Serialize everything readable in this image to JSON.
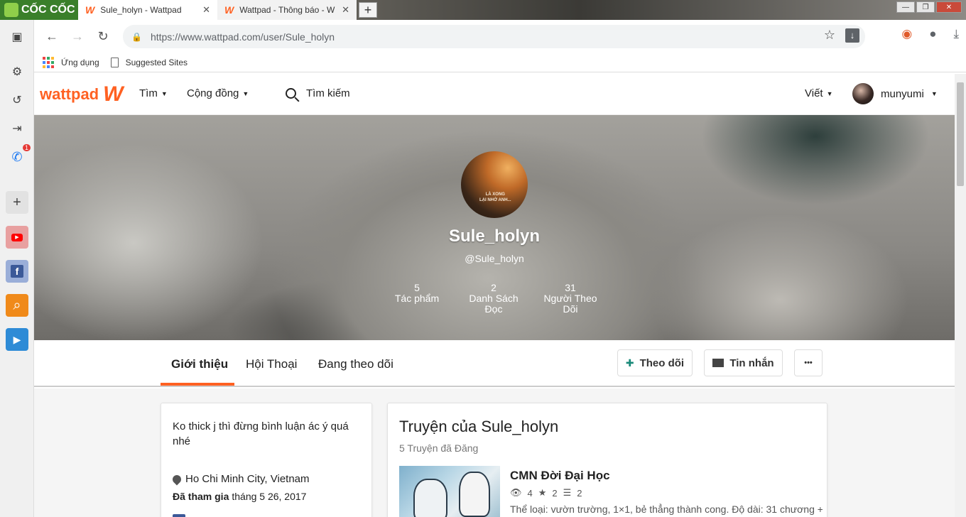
{
  "browser": {
    "brand": "CỐC CỐC",
    "tabs": [
      {
        "title": "Sule_holyn - Wattpad",
        "close": "✕"
      },
      {
        "title": "Wattpad - Thông báo - W",
        "close": "✕"
      }
    ],
    "new_tab": "+",
    "window_buttons": [
      "—",
      "❐",
      "✕"
    ],
    "url": "https://www.wattpad.com/user/Sule_holyn",
    "bookmarks": [
      {
        "label": "Ứng dụng"
      },
      {
        "label": "Suggested Sites"
      }
    ],
    "sidebar_badge": "1"
  },
  "wattpad": {
    "logo_text": "wattpad",
    "logo_mark": "W",
    "nav": {
      "browse": "Tìm",
      "community": "Cộng đồng",
      "search": "Tìm kiếm",
      "write": "Viết",
      "username": "munyumi"
    }
  },
  "profile": {
    "name": "Sule_holyn",
    "handle": "@Sule_holyn",
    "avatar_caption": "LÀ XONG\nLẠI NHỚ ANH...",
    "stats": [
      {
        "value": "5",
        "label": "Tác phẩm"
      },
      {
        "value": "2",
        "label": "Danh Sách Đọc"
      },
      {
        "value": "31",
        "label": "Người Theo Dõi"
      }
    ],
    "tabs": [
      "Giới thiệu",
      "Hội Thoại",
      "Đang theo dõi"
    ],
    "buttons": {
      "follow": "Theo dõi",
      "message": "Tin nhắn",
      "more": "•••"
    }
  },
  "about": {
    "bio": "Ko thick j thì đừng bình luận ác ý quá nhé",
    "location": "Ho Chi Minh City, Vietnam",
    "joined_label": "Đã tham gia",
    "joined_date": "tháng 5 26, 2017"
  },
  "stories": {
    "title": "Truyện của Sule_holyn",
    "subtitle": "5 Truyện đã Đăng",
    "items": [
      {
        "title": "CMN Đời Đại Học",
        "reads": "4",
        "votes": "2",
        "parts": "2",
        "description": "Thể loại: vườn trường, 1×1, bẻ thẳng thành cong. Độ dài: 31 chương +"
      }
    ]
  },
  "colors": {
    "accent": "#ff6122",
    "follow_icon": "#1a8a7a"
  }
}
